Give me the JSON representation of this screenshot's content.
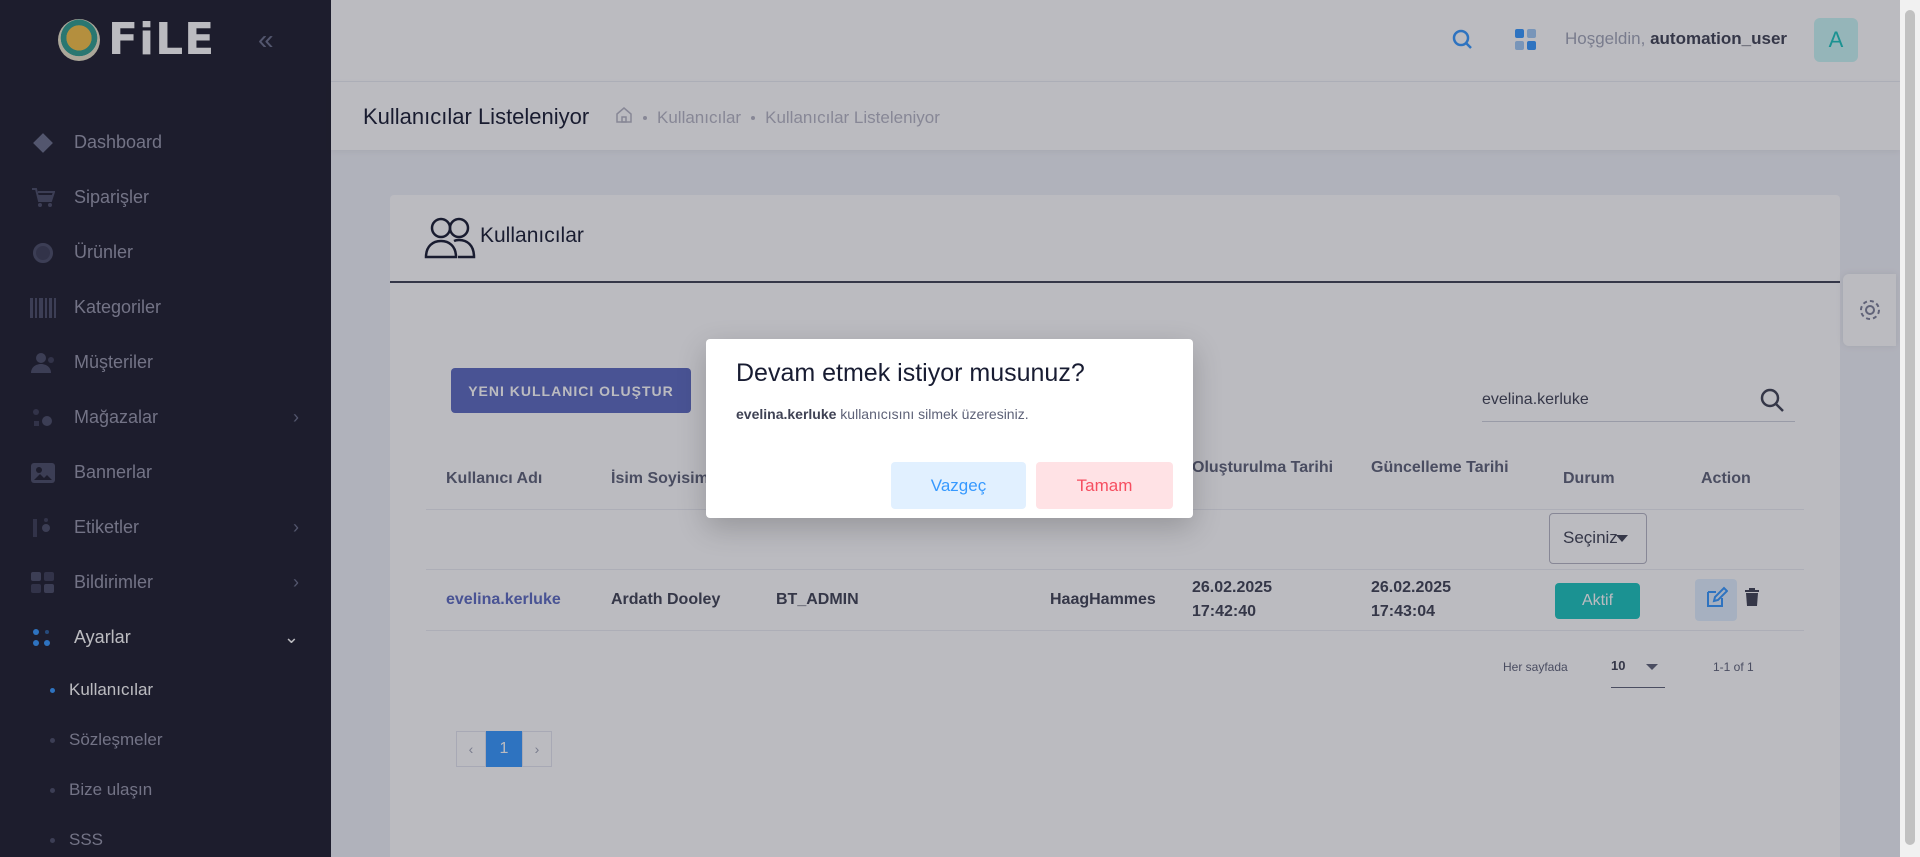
{
  "colors": {
    "sidebar_bg": "#1e1e2d",
    "primary": "#5c6bc0",
    "accent": "#3699ff",
    "success": "#1bc5bd",
    "danger": "#f64e60"
  },
  "sidebar": {
    "logo_text": "FiLE",
    "items": [
      {
        "label": "Dashboard",
        "icon": "diamond-icon"
      },
      {
        "label": "Siparişler",
        "icon": "cart-icon"
      },
      {
        "label": "Ürünler",
        "icon": "product-icon"
      },
      {
        "label": "Kategoriler",
        "icon": "barcode-icon"
      },
      {
        "label": "Müşteriler",
        "icon": "customers-icon"
      },
      {
        "label": "Mağazalar",
        "icon": "store-icon"
      },
      {
        "label": "Bannerlar",
        "icon": "image-icon"
      },
      {
        "label": "Etiketler",
        "icon": "tag-icon"
      },
      {
        "label": "Bildirimler",
        "icon": "notification-icon"
      },
      {
        "label": "Ayarlar",
        "icon": "settings-icon"
      }
    ],
    "sub_items": [
      {
        "label": "Kullanıcılar"
      },
      {
        "label": "Sözleşmeler"
      },
      {
        "label": "Bize ulaşın"
      },
      {
        "label": "SSS"
      }
    ]
  },
  "header": {
    "greeting": "Hoşgeldin,",
    "username": "automation_user",
    "avatar_letter": "A"
  },
  "subheader": {
    "title": "Kullanıcılar Listeleniyor",
    "breadcrumb": [
      "Kullanıcılar",
      "Kullanıcılar Listeleniyor"
    ]
  },
  "card": {
    "title": "Kullanıcılar",
    "new_button": "YENI KULLANICI OLUŞTUR",
    "search_value": "evelina.kerluke",
    "columns": [
      "Kullanıcı Adı",
      "İsim Soyisim",
      "Oluşturulma Tarihi",
      "Güncelleme Tarihi",
      "Durum",
      "Action"
    ],
    "status_filter": "Seçiniz",
    "rows": [
      {
        "username": "evelina.kerluke",
        "fullname": "Ardath Dooley",
        "role": "BT_ADMIN",
        "store": "HaagHammes",
        "created_date": "26.02.2025",
        "created_time": "17:42:40",
        "updated_date": "26.02.2025",
        "updated_time": "17:43:04",
        "status": "Aktif"
      }
    ],
    "per_page_label": "Her sayfada",
    "per_page": "10",
    "range": "1-1 of 1",
    "pager": {
      "prev": "‹",
      "current": "1",
      "next": "›"
    }
  },
  "dialog": {
    "title": "Devam etmek istiyor musunuz?",
    "message_user": "evelina.kerluke",
    "message_rest": " kullanıcısını silmek üzeresiniz.",
    "cancel": "Vazgeç",
    "ok": "Tamam"
  }
}
